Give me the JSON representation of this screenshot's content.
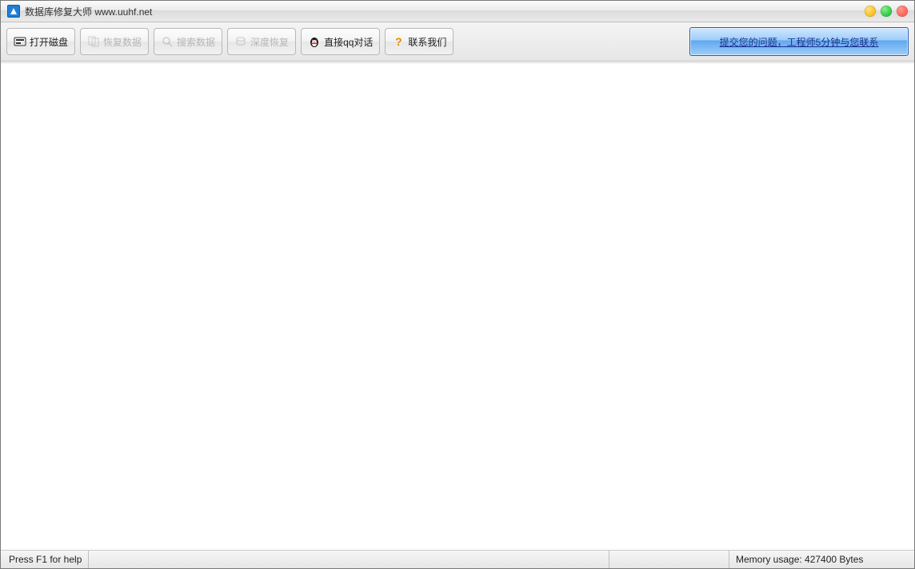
{
  "window": {
    "title": "数据库修复大师 www.uuhf.net"
  },
  "toolbar": {
    "open_disk": "打开磁盘",
    "recover_data": "恢复数据",
    "search_data": "搜索数据",
    "deep_recover": "深度恢复",
    "qq_chat": "直接qq对话",
    "contact_us": "联系我们",
    "promo": "提交您的问题，工程师5分钟与您联系"
  },
  "statusbar": {
    "help": "Press F1 for help",
    "memory": "Memory usage: 427400 Bytes"
  }
}
